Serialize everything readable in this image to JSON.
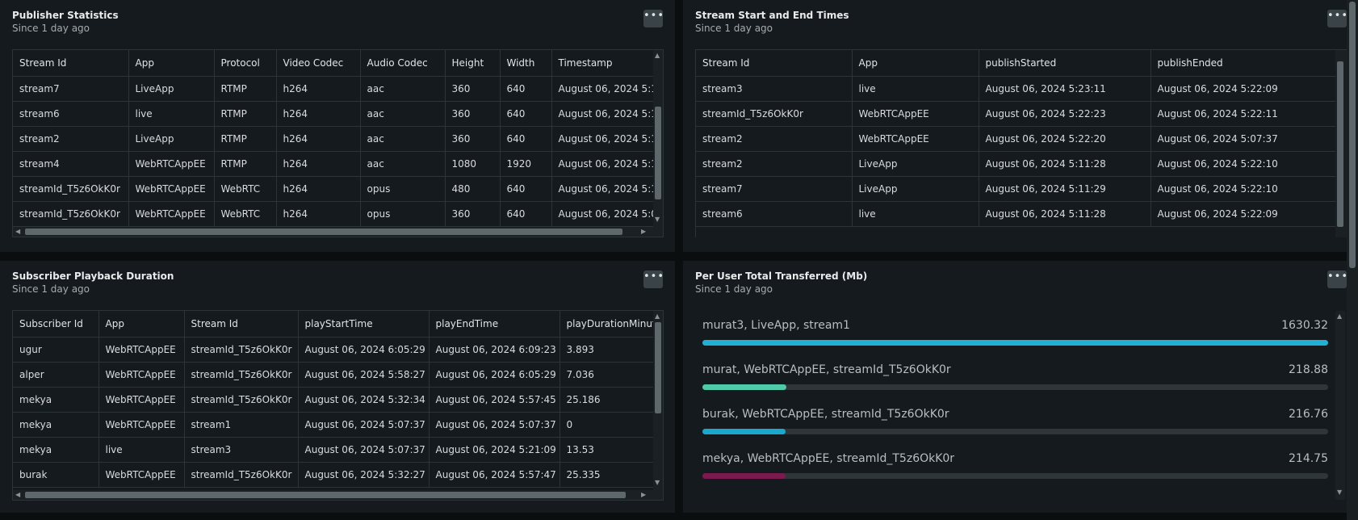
{
  "colors": {
    "bar1": "#21b0d4",
    "bar2": "#4fc9aa",
    "bar3": "#1aa8cc",
    "bar4": "#7a1a4f"
  },
  "publisher": {
    "title": "Publisher Statistics",
    "subtitle": "Since 1 day ago",
    "menu": "•••",
    "columns": [
      "Stream Id",
      "App",
      "Protocol",
      "Video Codec",
      "Audio Codec",
      "Height",
      "Width",
      "Timestamp"
    ],
    "rows": [
      [
        "stream7",
        "LiveApp",
        "RTMP",
        "h264",
        "aac",
        "360",
        "640",
        "August 06, 2024 5:1"
      ],
      [
        "stream6",
        "live",
        "RTMP",
        "h264",
        "aac",
        "360",
        "640",
        "August 06, 2024 5:1"
      ],
      [
        "stream2",
        "LiveApp",
        "RTMP",
        "h264",
        "aac",
        "360",
        "640",
        "August 06, 2024 5:1"
      ],
      [
        "stream4",
        "WebRTCAppEE",
        "RTMP",
        "h264",
        "aac",
        "1080",
        "1920",
        "August 06, 2024 5:1"
      ],
      [
        "streamId_T5z6OkK0r",
        "WebRTCAppEE",
        "WebRTC",
        "h264",
        "opus",
        "480",
        "640",
        "August 06, 2024 5:1"
      ],
      [
        "streamId_T5z6OkK0r",
        "WebRTCAppEE",
        "WebRTC",
        "h264",
        "opus",
        "360",
        "640",
        "August 06, 2024 5:0"
      ]
    ]
  },
  "streamTimes": {
    "title": "Stream Start and End Times",
    "subtitle": "Since 1 day ago",
    "menu": "•••",
    "columns": [
      "Stream Id",
      "App",
      "publishStarted",
      "publishEnded"
    ],
    "rows": [
      [
        "stream3",
        "live",
        "August 06, 2024 5:23:11",
        "August 06, 2024 5:22:09"
      ],
      [
        "streamId_T5z6OkK0r",
        "WebRTCAppEE",
        "August 06, 2024 5:22:23",
        "August 06, 2024 5:22:11"
      ],
      [
        "stream2",
        "WebRTCAppEE",
        "August 06, 2024 5:22:20",
        "August 06, 2024 5:07:37"
      ],
      [
        "stream2",
        "LiveApp",
        "August 06, 2024 5:11:28",
        "August 06, 2024 5:22:10"
      ],
      [
        "stream7",
        "LiveApp",
        "August 06, 2024 5:11:29",
        "August 06, 2024 5:22:10"
      ],
      [
        "stream6",
        "live",
        "August 06, 2024 5:11:28",
        "August 06, 2024 5:22:09"
      ]
    ]
  },
  "subscriber": {
    "title": "Subscriber Playback Duration",
    "subtitle": "Since 1 day ago",
    "menu": "•••",
    "columns": [
      "Subscriber Id",
      "App",
      "Stream Id",
      "playStartTime",
      "playEndTime",
      "playDurationMinut"
    ],
    "rows": [
      [
        "ugur",
        "WebRTCAppEE",
        "streamId_T5z6OkK0r",
        "August 06, 2024 6:05:29",
        "August 06, 2024 6:09:23",
        "3.893"
      ],
      [
        "alper",
        "WebRTCAppEE",
        "streamId_T5z6OkK0r",
        "August 06, 2024 5:58:27",
        "August 06, 2024 6:05:29",
        "7.036"
      ],
      [
        "mekya",
        "WebRTCAppEE",
        "streamId_T5z6OkK0r",
        "August 06, 2024 5:32:34",
        "August 06, 2024 5:57:45",
        "25.186"
      ],
      [
        "mekya",
        "WebRTCAppEE",
        "stream1",
        "August 06, 2024 5:07:37",
        "August 06, 2024 5:07:37",
        "0"
      ],
      [
        "mekya",
        "live",
        "stream3",
        "August 06, 2024 5:07:37",
        "August 06, 2024 5:21:09",
        "13.53"
      ],
      [
        "burak",
        "WebRTCAppEE",
        "streamId_T5z6OkK0r",
        "August 06, 2024 5:32:27",
        "August 06, 2024 5:57:47",
        "25.335"
      ]
    ]
  },
  "transfer": {
    "title": "Per User Total Transferred (Mb)",
    "subtitle": "Since 1 day ago",
    "menu": "•••",
    "max": 1630.32,
    "items": [
      {
        "label": "murat3, LiveApp, stream1",
        "value": "1630.32",
        "num": 1630.32
      },
      {
        "label": "murat, WebRTCAppEE, streamId_T5z6OkK0r",
        "value": "218.88",
        "num": 218.88
      },
      {
        "label": "burak, WebRTCAppEE, streamId_T5z6OkK0r",
        "value": "216.76",
        "num": 216.76
      },
      {
        "label": "mekya, WebRTCAppEE, streamId_T5z6OkK0r",
        "value": "214.75",
        "num": 214.75
      }
    ]
  }
}
